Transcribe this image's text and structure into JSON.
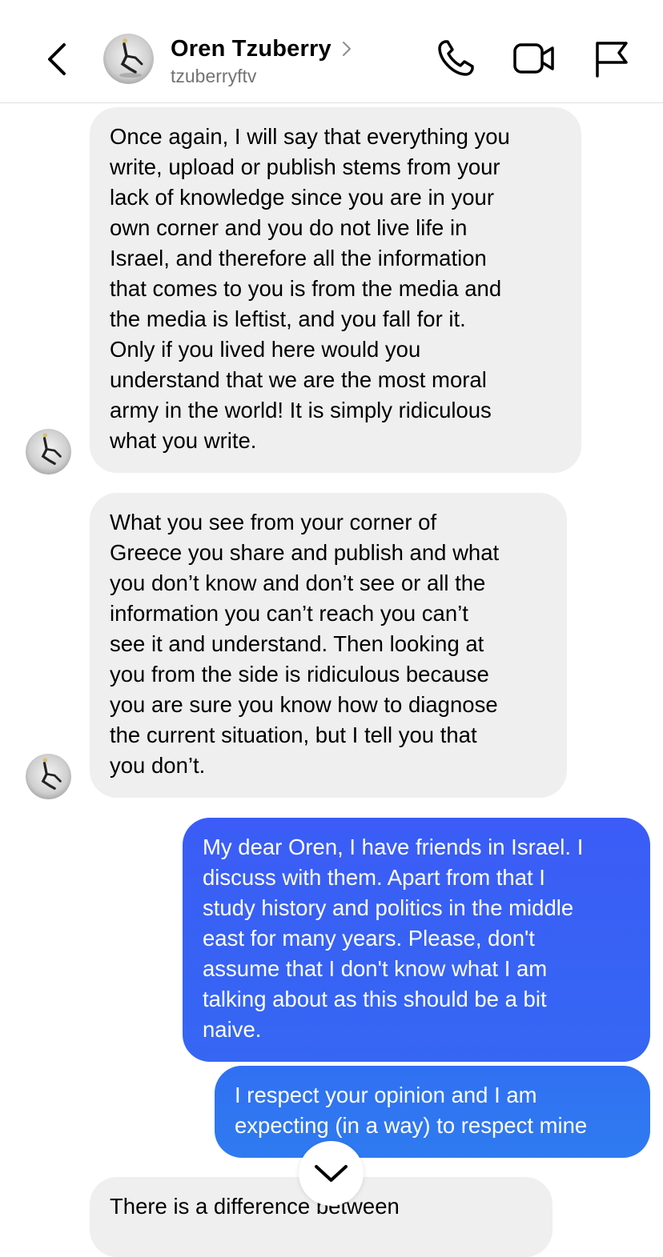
{
  "header": {
    "contact_name": "Oren Tzuberry",
    "username": "tzuberryftv",
    "icons": {
      "back": "chevron-left-icon",
      "profile_chevron": "chevron-right-icon",
      "call": "phone-icon",
      "video": "video-camera-icon",
      "report": "flag-icon"
    }
  },
  "messages": [
    {
      "sender": "Oren Tzuberry",
      "direction": "incoming",
      "text": "Once again, I will say that everything you\nwrite, upload or publish stems from your\nlack of knowledge since you are in your\nown corner and you do not live life in\nIsrael, and therefore all the information\nthat comes to you is from the media and\nthe media is leftist, and you fall for it.\nOnly if you lived here would you\nunderstand that we are the most moral\narmy in the world! It is simply ridiculous\nwhat you write."
    },
    {
      "sender": "Oren Tzuberry",
      "direction": "incoming",
      "text": "What you see from your corner of\nGreece you share and publish and what\nyou don’t know and don’t see or all the\ninformation you can’t reach you can’t\nsee it and understand. Then looking at\nyou from the side is ridiculous because\nyou are sure you know how to diagnose\nthe current situation, but I tell you that\nyou don’t."
    },
    {
      "sender": "me",
      "direction": "outgoing",
      "text": "My dear Oren, I have friends in Israel. I\ndiscuss with them. Apart from that I\nstudy history and politics in the middle\neast for many years. Please, don't\nassume that I don't know what I am\ntalking about as this should be a bit\nnaive."
    },
    {
      "sender": "me",
      "direction": "outgoing",
      "text": "I respect your opinion and I am\nexpecting (in a way) to respect mine"
    },
    {
      "sender": "Oren Tzuberry",
      "direction": "incoming",
      "text": "There is a difference between"
    }
  ],
  "scroll_button_icon": "chevron-down-icon",
  "colors": {
    "incoming_bubble": "#efefef",
    "outgoing_gradient_top": "#3b5cf6",
    "outgoing_gradient_bottom": "#2f7bf0",
    "secondary_text": "#737373",
    "divider": "#dedede"
  }
}
